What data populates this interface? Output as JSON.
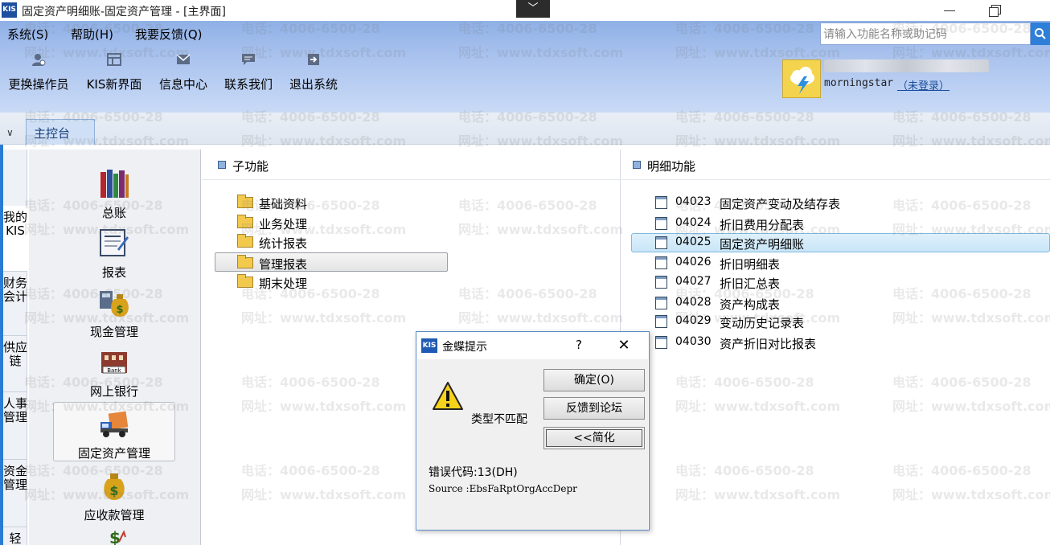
{
  "window": {
    "app_icon": "KIS",
    "title": "固定资产明细账-固定资产管理 - [主界面]",
    "dropdown_glyph": "﹀"
  },
  "menu": {
    "items": [
      "系统(S)",
      "帮助(H)",
      "我要反馈(Q)"
    ]
  },
  "search": {
    "placeholder": "请输入功能名称或助记码",
    "icon": "search-icon"
  },
  "toolbar": {
    "items": [
      {
        "label": "更换操作员",
        "icon": "user-switch-icon"
      },
      {
        "label": "KIS新界面",
        "icon": "layout-icon"
      },
      {
        "label": "信息中心",
        "icon": "mail-icon"
      },
      {
        "label": "联系我们",
        "icon": "chat-icon"
      },
      {
        "label": "退出系统",
        "icon": "exit-icon"
      }
    ]
  },
  "user": {
    "name": "morningstar",
    "status": "（未登录）",
    "avatar_icon": "weather-storm-icon",
    "avatar_color": "#f4d44e"
  },
  "tabs": {
    "collapse_glyph": "∨",
    "main": "主控台"
  },
  "vertical_tabs": [
    "我的KIS",
    "财务会计",
    "供应链",
    "人事管理",
    "资金管理",
    "轻"
  ],
  "modules": [
    {
      "label": "总账",
      "icon": "books-icon"
    },
    {
      "label": "报表",
      "icon": "report-icon"
    },
    {
      "label": "现金管理",
      "icon": "cash-bag-icon"
    },
    {
      "label": "网上银行",
      "icon": "bank-icon"
    },
    {
      "label": "固定资产管理",
      "icon": "truck-icon"
    },
    {
      "label": "应收款管理",
      "icon": "money-bag-icon"
    }
  ],
  "subfunctions": {
    "title": "子功能",
    "items": [
      "基础资料",
      "业务处理",
      "统计报表",
      "管理报表",
      "期末处理"
    ]
  },
  "details": {
    "title": "明细功能",
    "items": [
      {
        "code": "04023",
        "label": "固定资产变动及结存表"
      },
      {
        "code": "04024",
        "label": "折旧费用分配表"
      },
      {
        "code": "04025",
        "label": "固定资产明细账"
      },
      {
        "code": "04026",
        "label": "折旧明细表"
      },
      {
        "code": "04027",
        "label": "折旧汇总表"
      },
      {
        "code": "04028",
        "label": "资产构成表"
      },
      {
        "code": "04029",
        "label": "变动历史记录表"
      },
      {
        "code": "04030",
        "label": "资产折旧对比报表"
      }
    ]
  },
  "dialog": {
    "icon": "KIS",
    "title": "金蝶提示",
    "help": "?",
    "close": "✕",
    "message": "类型不匹配",
    "buttons": {
      "ok": "确定(O)",
      "feedback": "反馈到论坛",
      "simplify": "<<简化"
    },
    "error_code": "错误代码:13(DH)",
    "source": "Source   :EbsFaRptOrgAccDepr"
  },
  "watermark": {
    "phone": "电话：4006-6500-28",
    "site": "网址：www.tdxsoft.com"
  },
  "colors": {
    "accent": "#2a7bd4",
    "header": "#aac3ee",
    "selection": "#c9e6f8"
  }
}
